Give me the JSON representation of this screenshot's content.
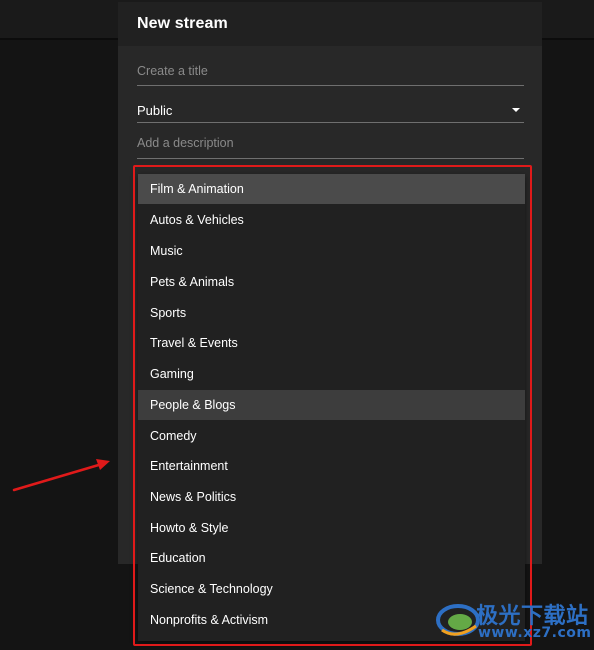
{
  "dialog": {
    "title": "New stream",
    "title_field": {
      "value": "",
      "placeholder": "Create a title"
    },
    "privacy_field": {
      "value": "Public"
    },
    "description_field": {
      "value": "",
      "placeholder": "Add a description"
    }
  },
  "category_dropdown": {
    "items": [
      {
        "label": "Film & Animation"
      },
      {
        "label": "Autos & Vehicles"
      },
      {
        "label": "Music"
      },
      {
        "label": "Pets & Animals"
      },
      {
        "label": "Sports"
      },
      {
        "label": "Travel & Events"
      },
      {
        "label": "Gaming"
      },
      {
        "label": "People & Blogs"
      },
      {
        "label": "Comedy"
      },
      {
        "label": "Entertainment"
      },
      {
        "label": "News & Politics"
      },
      {
        "label": "Howto & Style"
      },
      {
        "label": "Education"
      },
      {
        "label": "Science & Technology"
      },
      {
        "label": "Nonprofits & Activism"
      }
    ],
    "selected": "Film & Animation",
    "hovered": "People & Blogs"
  },
  "annotation": {
    "highlight_color": "#e01a1a",
    "arrow_color": "#e01a1a"
  },
  "watermark": {
    "brand_cn": "极光下载站",
    "url": "www.xz7.com",
    "color": "#2d6fc4"
  }
}
